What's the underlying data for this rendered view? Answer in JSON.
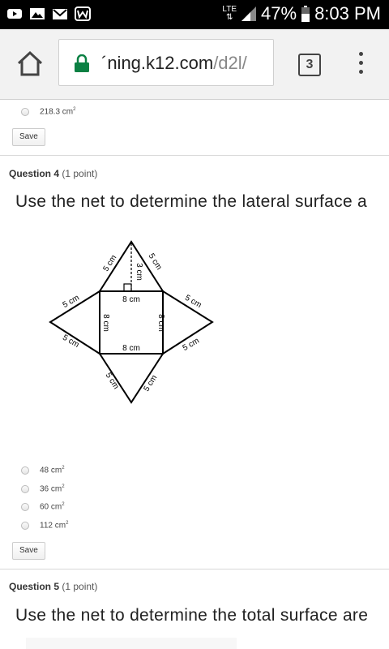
{
  "status_bar": {
    "network": "LTE",
    "battery": "47%",
    "time": "8:03 PM",
    "icons": [
      "youtube-icon",
      "gallery-icon",
      "gmail-icon",
      "word-icon",
      "signal-icon",
      "battery-icon"
    ]
  },
  "browser": {
    "url_host": "´ning.k12.com",
    "url_path": "/d2l/",
    "tab_count": "3"
  },
  "prev_question": {
    "option": {
      "value": "218.3 cm",
      "sup": "2"
    },
    "save_label": "Save"
  },
  "question4": {
    "label": "Question 4",
    "points": "(1 point)",
    "text": "Use the net to determine the lateral surface a",
    "figure_labels": {
      "top_left": "5 cm",
      "top_right": "5 cm",
      "height": "3 cm",
      "square_top": "8 cm",
      "square_bottom": "8 cm",
      "square_left": "8 cm",
      "square_right": "8 cm",
      "left_top": "5 cm",
      "left_bottom": "5 cm",
      "right_top": "5 cm",
      "right_bottom": "5 cm",
      "bottom_left": "5 cm",
      "bottom_right": "5 cm"
    },
    "options": [
      {
        "value": "48 cm",
        "sup": "2"
      },
      {
        "value": "36 cm",
        "sup": "2"
      },
      {
        "value": "60 cm",
        "sup": "2"
      },
      {
        "value": "112 cm",
        "sup": "2"
      }
    ],
    "save_label": "Save"
  },
  "question5": {
    "label": "Question 5",
    "points": "(1 point)",
    "text": "Use the net to determine the total surface are"
  }
}
